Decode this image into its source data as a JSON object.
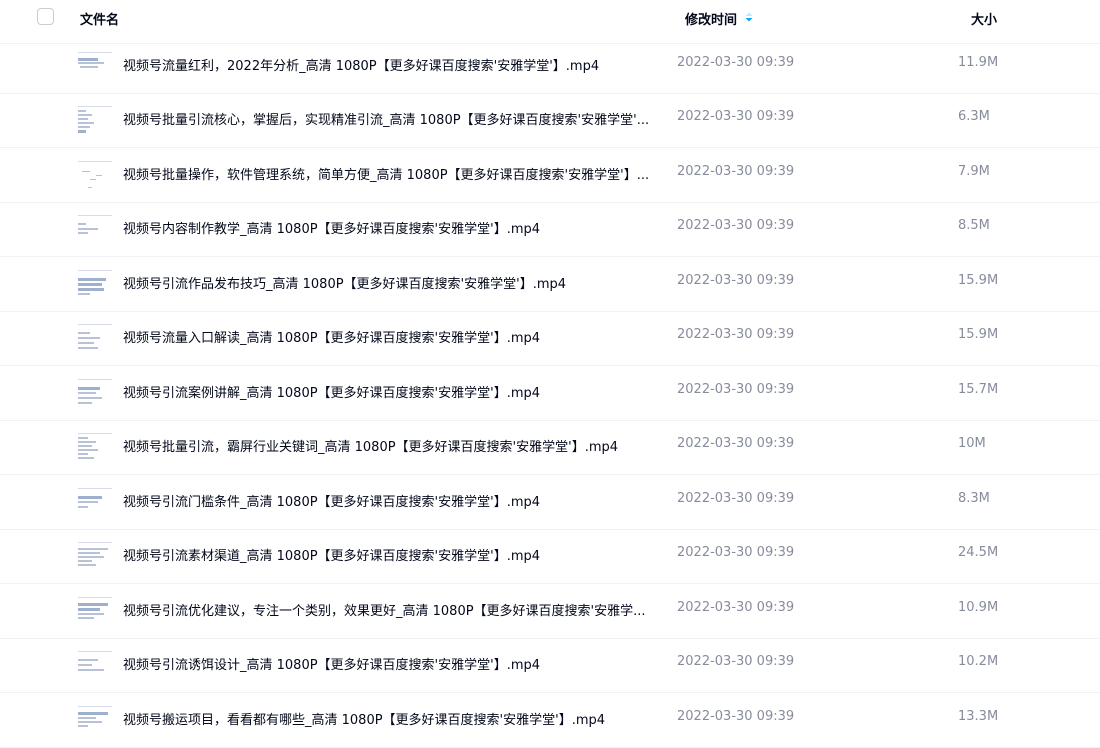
{
  "header": {
    "name_label": "文件名",
    "time_label": "修改时间",
    "size_label": "大小"
  },
  "files": [
    {
      "name": "视频号流量红利，2022年分析_高清 1080P【更多好课百度搜索'安雅学堂'】.mp4",
      "time": "2022-03-30 09:39",
      "size": "11.9M"
    },
    {
      "name": "视频号批量引流核心，掌握后，实现精准引流_高清 1080P【更多好课百度搜索'安雅学堂'...",
      "time": "2022-03-30 09:39",
      "size": "6.3M"
    },
    {
      "name": "视频号批量操作，软件管理系统，简单方便_高清 1080P【更多好课百度搜索'安雅学堂'】...",
      "time": "2022-03-30 09:39",
      "size": "7.9M"
    },
    {
      "name": "视频号内容制作教学_高清 1080P【更多好课百度搜索'安雅学堂'】.mp4",
      "time": "2022-03-30 09:39",
      "size": "8.5M"
    },
    {
      "name": "视频号引流作品发布技巧_高清 1080P【更多好课百度搜索'安雅学堂'】.mp4",
      "time": "2022-03-30 09:39",
      "size": "15.9M"
    },
    {
      "name": "视频号流量入口解读_高清 1080P【更多好课百度搜索'安雅学堂'】.mp4",
      "time": "2022-03-30 09:39",
      "size": "15.9M"
    },
    {
      "name": "视频号引流案例讲解_高清 1080P【更多好课百度搜索'安雅学堂'】.mp4",
      "time": "2022-03-30 09:39",
      "size": "15.7M"
    },
    {
      "name": "视频号批量引流，霸屏行业关键词_高清 1080P【更多好课百度搜索'安雅学堂'】.mp4",
      "time": "2022-03-30 09:39",
      "size": "10M"
    },
    {
      "name": "视频号引流门槛条件_高清 1080P【更多好课百度搜索'安雅学堂'】.mp4",
      "time": "2022-03-30 09:39",
      "size": "8.3M"
    },
    {
      "name": "视频号引流素材渠道_高清 1080P【更多好课百度搜索'安雅学堂'】.mp4",
      "time": "2022-03-30 09:39",
      "size": "24.5M"
    },
    {
      "name": "视频号引流优化建议，专注一个类别，效果更好_高清 1080P【更多好课百度搜索'安雅学...",
      "time": "2022-03-30 09:39",
      "size": "10.9M"
    },
    {
      "name": "视频号引流诱饵设计_高清 1080P【更多好课百度搜索'安雅学堂'】.mp4",
      "time": "2022-03-30 09:39",
      "size": "10.2M"
    },
    {
      "name": "视频号搬运项目，看看都有哪些_高清 1080P【更多好课百度搜索'安雅学堂'】.mp4",
      "time": "2022-03-30 09:39",
      "size": "13.3M"
    }
  ],
  "icons": {
    "checkbox": "select-all-checkbox",
    "sort": "sort-descending-icon",
    "thumbnail": "video-thumbnail"
  },
  "colors": {
    "accent": "#06a7ff",
    "muted_text": "#878c9c",
    "text": "#03081a"
  }
}
